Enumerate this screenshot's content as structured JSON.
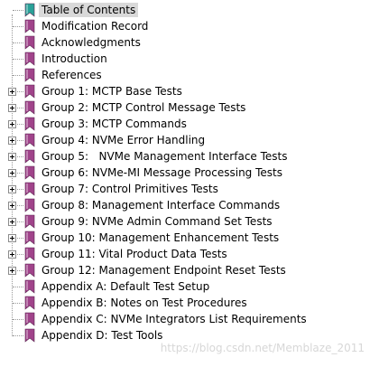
{
  "tree": {
    "items": [
      {
        "label": "Table of Contents",
        "expandable": false,
        "selected": true,
        "icon_color": "#2aa198"
      },
      {
        "label": "Modification Record",
        "expandable": false,
        "selected": false,
        "icon_color": "#a0438a"
      },
      {
        "label": "Acknowledgments",
        "expandable": false,
        "selected": false,
        "icon_color": "#a0438a"
      },
      {
        "label": "Introduction",
        "expandable": false,
        "selected": false,
        "icon_color": "#a0438a"
      },
      {
        "label": "References",
        "expandable": false,
        "selected": false,
        "icon_color": "#a0438a"
      },
      {
        "label": "Group 1: MCTP Base Tests",
        "expandable": true,
        "selected": false,
        "icon_color": "#a0438a"
      },
      {
        "label": "Group 2: MCTP Control Message Tests",
        "expandable": true,
        "selected": false,
        "icon_color": "#a0438a"
      },
      {
        "label": "Group 3: MCTP Commands",
        "expandable": true,
        "selected": false,
        "icon_color": "#a0438a"
      },
      {
        "label": "Group 4: NVMe Error Handling",
        "expandable": true,
        "selected": false,
        "icon_color": "#a0438a"
      },
      {
        "label": "Group 5:   NVMe Management Interface Tests",
        "expandable": true,
        "selected": false,
        "icon_color": "#a0438a"
      },
      {
        "label": "Group 6: NVMe-MI Message Processing Tests",
        "expandable": true,
        "selected": false,
        "icon_color": "#a0438a"
      },
      {
        "label": "Group 7: Control Primitives Tests",
        "expandable": true,
        "selected": false,
        "icon_color": "#a0438a"
      },
      {
        "label": "Group 8: Management Interface Commands",
        "expandable": true,
        "selected": false,
        "icon_color": "#a0438a"
      },
      {
        "label": "Group 9: NVMe Admin Command Set Tests",
        "expandable": true,
        "selected": false,
        "icon_color": "#a0438a"
      },
      {
        "label": "Group 10: Management Enhancement Tests",
        "expandable": true,
        "selected": false,
        "icon_color": "#a0438a"
      },
      {
        "label": "Group 11: Vital Product Data Tests",
        "expandable": true,
        "selected": false,
        "icon_color": "#a0438a"
      },
      {
        "label": "Group 12: Management Endpoint Reset Tests",
        "expandable": true,
        "selected": false,
        "icon_color": "#a0438a"
      },
      {
        "label": "Appendix A: Default Test Setup",
        "expandable": false,
        "selected": false,
        "icon_color": "#a0438a"
      },
      {
        "label": "Appendix B: Notes on Test Procedures",
        "expandable": false,
        "selected": false,
        "icon_color": "#a0438a"
      },
      {
        "label": "Appendix C: NVMe Integrators List Requirements",
        "expandable": false,
        "selected": false,
        "icon_color": "#a0438a"
      },
      {
        "label": "Appendix D: Test Tools",
        "expandable": false,
        "selected": false,
        "icon_color": "#a0438a"
      }
    ]
  },
  "watermark": "https://blog.csdn.net/Memblaze_2011"
}
